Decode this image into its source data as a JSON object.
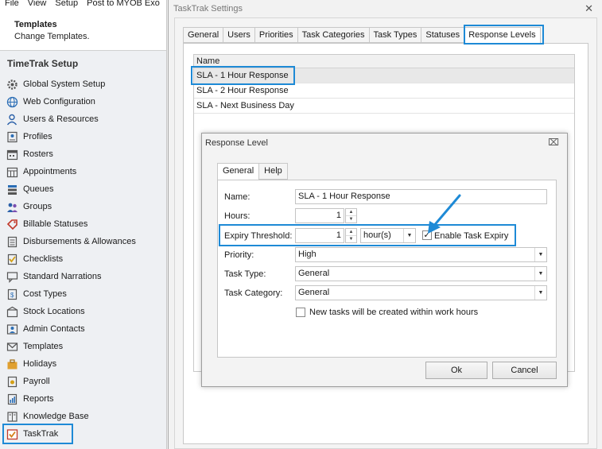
{
  "menubar": [
    "File",
    "View",
    "Setup",
    "Post to MYOB Exo"
  ],
  "templates_header": {
    "title": "Templates",
    "subtitle": "Change Templates."
  },
  "setup_title": "TimeTrak Setup",
  "nav_items": [
    {
      "label": "Global System Setup",
      "icon": "gear-icon"
    },
    {
      "label": "Web Configuration",
      "icon": "globe-icon"
    },
    {
      "label": "Users & Resources",
      "icon": "users-icon"
    },
    {
      "label": "Profiles",
      "icon": "profile-icon"
    },
    {
      "label": "Rosters",
      "icon": "calendar-icon"
    },
    {
      "label": "Appointments",
      "icon": "calendar-grid-icon"
    },
    {
      "label": "Queues",
      "icon": "queue-icon"
    },
    {
      "label": "Groups",
      "icon": "group-icon"
    },
    {
      "label": "Billable Statuses",
      "icon": "tag-icon"
    },
    {
      "label": "Disbursements & Allowances",
      "icon": "document-icon"
    },
    {
      "label": "Checklists",
      "icon": "checklist-icon"
    },
    {
      "label": "Standard Narrations",
      "icon": "speech-icon"
    },
    {
      "label": "Cost Types",
      "icon": "cost-icon"
    },
    {
      "label": "Stock Locations",
      "icon": "location-icon"
    },
    {
      "label": "Admin Contacts",
      "icon": "contact-icon"
    },
    {
      "label": "Templates",
      "icon": "envelope-icon"
    },
    {
      "label": "Holidays",
      "icon": "suitcase-icon"
    },
    {
      "label": "Payroll",
      "icon": "payroll-icon"
    },
    {
      "label": "Reports",
      "icon": "report-icon"
    },
    {
      "label": "Knowledge Base",
      "icon": "book-icon"
    },
    {
      "label": "TaskTrak",
      "icon": "tasktrak-icon"
    }
  ],
  "window": {
    "title": "TaskTrak Settings",
    "close": "✕",
    "tabs": [
      "General",
      "Users",
      "Priorities",
      "Task Categories",
      "Task Types",
      "Statuses",
      "Response Levels"
    ],
    "active_tab": "Response Levels",
    "list_header": "Name",
    "rows": [
      "SLA - 1 Hour Response",
      "SLA - 2 Hour Response",
      "SLA - Next Business Day"
    ]
  },
  "dialog": {
    "title": "Response Level",
    "close": "⌧",
    "tabs": [
      "General",
      "Help"
    ],
    "name_label": "Name:",
    "name_value": "SLA - 1 Hour Response",
    "hours_label": "Hours:",
    "hours_value": "1",
    "expiry_label": "Expiry Threshold:",
    "expiry_value": "1",
    "expiry_unit": "hour(s)",
    "enable_expiry_label": "Enable Task Expiry",
    "enable_expiry_checked": "✓",
    "priority_label": "Priority:",
    "priority_value": "High",
    "task_type_label": "Task Type:",
    "task_type_value": "General",
    "task_category_label": "Task Category:",
    "task_category_value": "General",
    "work_hours_label": "New tasks will be created within work hours",
    "ok_label": "Ok",
    "cancel_label": "Cancel"
  },
  "colors": {
    "highlight": "#1e8ad6",
    "selected_row": "#e8e8e8"
  }
}
